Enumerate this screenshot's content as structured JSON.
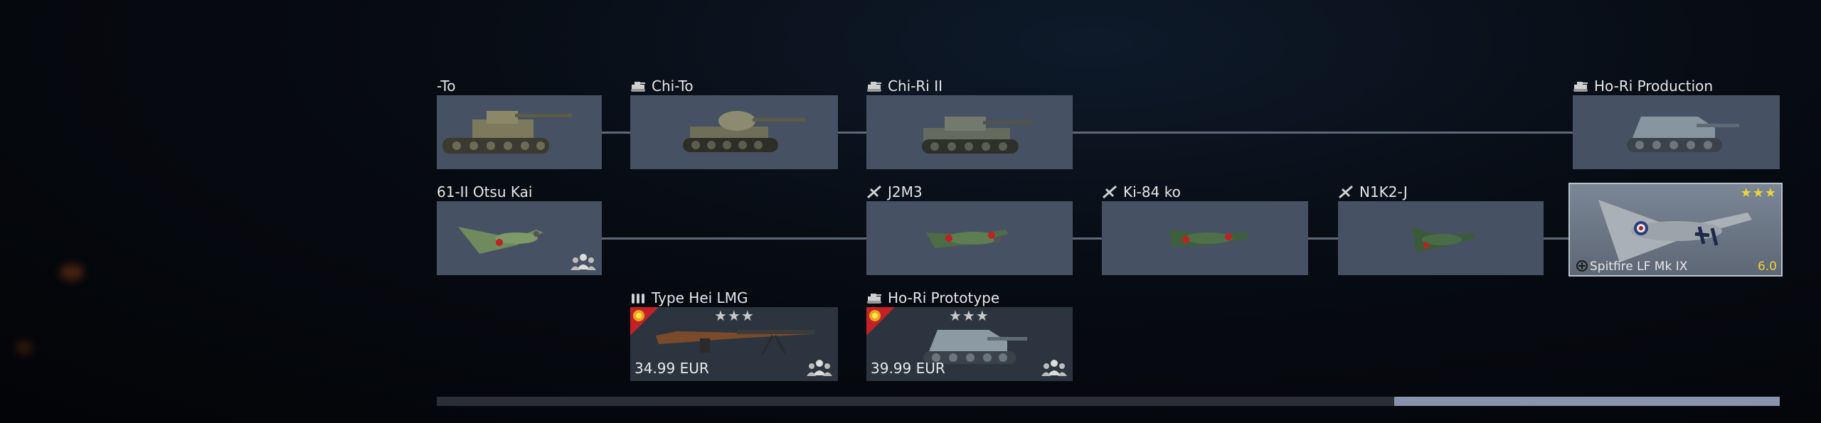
{
  "rows": {
    "row1": [
      {
        "name": "-To",
        "type_icon": "tank-icon"
      },
      {
        "name": "Chi-To",
        "type_icon": "tank-icon"
      },
      {
        "name": "Chi-Ri II",
        "type_icon": "tank-icon"
      },
      {
        "name": "Ho-Ri Production",
        "type_icon": "tank-icon"
      }
    ],
    "row2": [
      {
        "name": "61-II Otsu Kai",
        "type_icon": "plane-icon"
      },
      {
        "name": "J2M3",
        "type_icon": "plane-icon"
      },
      {
        "name": "Ki-84 ko",
        "type_icon": "plane-icon"
      },
      {
        "name": "N1K2-J",
        "type_icon": "plane-icon"
      },
      {
        "name": "Spitfire LF Mk IX",
        "type_icon": "premium-plane-icon",
        "stars": "★★★",
        "br": "6.0"
      }
    ],
    "row3": [
      {
        "name": "Type Hei LMG",
        "type_icon": "ammo-icon",
        "stars": "★★★",
        "price": "34.99 EUR"
      },
      {
        "name": "Ho-Ri Prototype",
        "type_icon": "tank-icon",
        "stars": "★★★",
        "price": "39.99 EUR"
      }
    ]
  },
  "colors": {
    "card": "#465263",
    "premium_flag": "#c4202a",
    "scroll_thumb": "#8893ac",
    "gold": "#f0d23a"
  }
}
